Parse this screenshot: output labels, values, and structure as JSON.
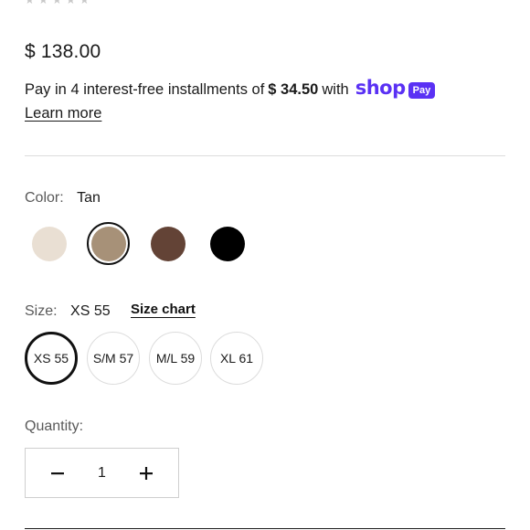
{
  "price": "$ 138.00",
  "installments": {
    "prefix": "Pay in 4 interest-free installments of",
    "amount": "$ 34.50",
    "suffix": "with",
    "brand_word": "shop",
    "badge": "Pay",
    "learn_more": "Learn more",
    "brand_color": "#5a31f4"
  },
  "color": {
    "label": "Color:",
    "selected": "Tan",
    "swatches": [
      {
        "name": "Cream",
        "hex": "#e9dfd3"
      },
      {
        "name": "Tan",
        "hex": "#a79178",
        "selected": true
      },
      {
        "name": "Brown",
        "hex": "#634336"
      },
      {
        "name": "Black",
        "hex": "#000000"
      }
    ]
  },
  "size": {
    "label": "Size:",
    "selected": "XS 55",
    "chart_link": "Size chart",
    "options": [
      "XS 55",
      "S/M 57",
      "M/L 59",
      "XL 61"
    ]
  },
  "quantity": {
    "label": "Quantity:",
    "value": "1",
    "minus_icon": "minus-icon",
    "plus_icon": "plus-icon"
  }
}
